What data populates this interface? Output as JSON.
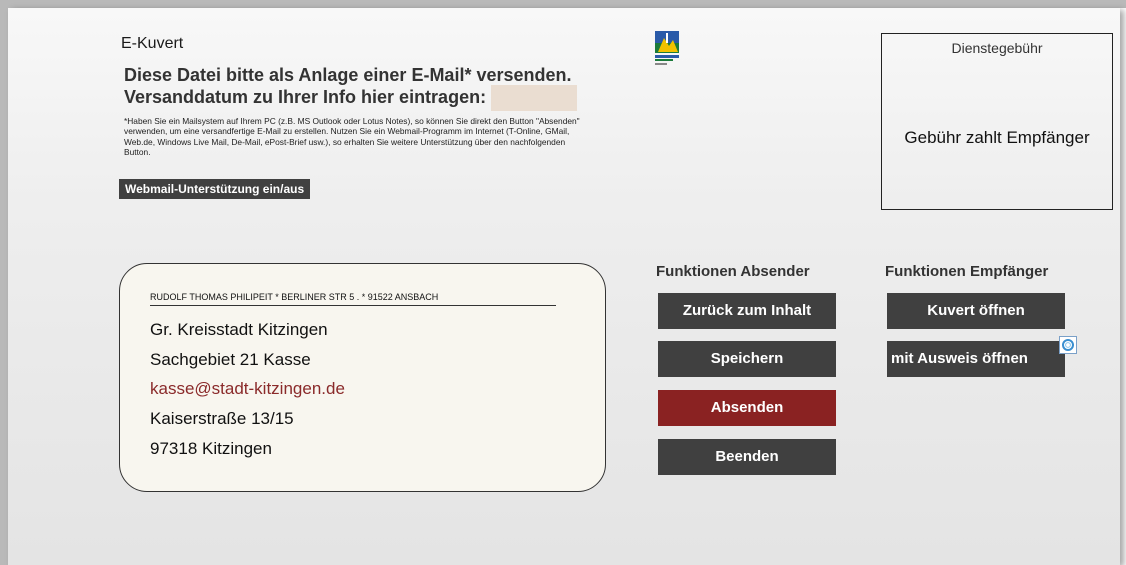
{
  "header": {
    "title": "E-Kuvert",
    "line1": "Diese Datei bitte als Anlage einer E-Mail* versenden.",
    "line2": "Versanddatum zu Ihrer Info hier eintragen:",
    "date_value": "",
    "footnote": "*Haben Sie ein Mailsystem auf Ihrem PC (z.B. MS Outlook oder Lotus Notes), so können Sie direkt den Button \"Absenden\" verwenden, um eine versandfertige E-Mail zu erstellen. Nutzen Sie ein Webmail-Programm im Internet (T-Online, GMail, Web.de, Windows Live Mail, De-Mail, ePost-Brief usw.), so erhalten Sie weitere Unterstützung über den nachfolgenden Button.",
    "webmail_button": "Webmail-Unterstützung ein/aus"
  },
  "logo": {
    "icon": "kitzingen-logo",
    "colors": [
      "#1a7a3a",
      "#f2c200",
      "#2a5aa8"
    ]
  },
  "fee": {
    "label": "Dienstegebühr",
    "value": "Gebühr zahlt Empfänger"
  },
  "address": {
    "sender": "RUDOLF THOMAS PHILIPEIT  * BERLINER STR 5 .  * 91522  ANSBACH",
    "lines": [
      "Gr. Kreisstadt Kitzingen",
      "Sachgebiet 21 Kasse",
      "kasse@stadt-kitzingen.de",
      "Kaiserstraße 13/15",
      "97318 Kitzingen"
    ]
  },
  "sender_functions": {
    "heading": "Funktionen Absender",
    "back": "Zurück zum Inhalt",
    "save": "Speichern",
    "send": "Absenden",
    "quit": "Beenden"
  },
  "recipient_functions": {
    "heading": "Funktionen Empfänger",
    "open": "Kuvert öffnen",
    "open_id": "mit Ausweis öffnen"
  },
  "colors": {
    "button_dark": "#404040",
    "button_red": "#8a2222",
    "date_field": "#eaddd1",
    "email_text": "#8a2a2a"
  }
}
